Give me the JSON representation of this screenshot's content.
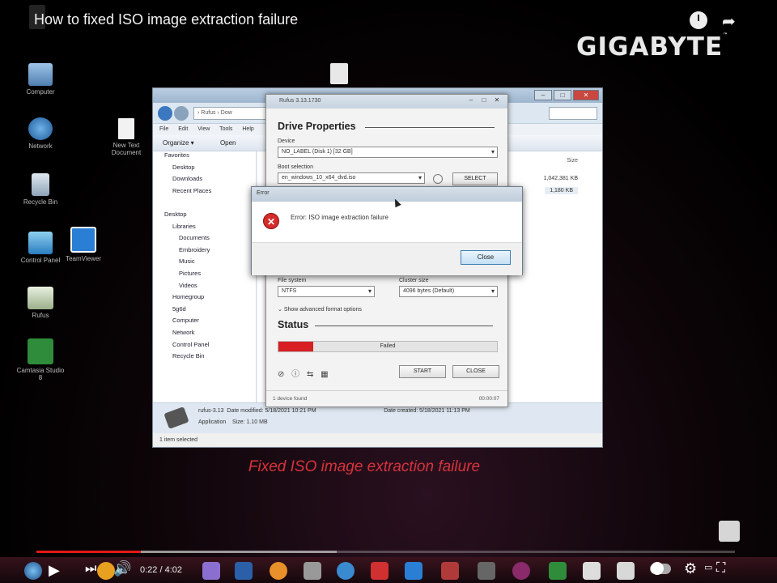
{
  "video": {
    "title": "How to fixed ISO image extraction failure",
    "brand": "GIGABYTE",
    "brand_tm": "™",
    "caption": "Fixed ISO image extraction failure",
    "time": "0:22 / 4:02",
    "progress": 0.15,
    "buffered": 0.43
  },
  "desktop": {
    "icons": [
      {
        "label": "Computer",
        "icon": "computer-icon"
      },
      {
        "label": "Network",
        "icon": "network-icon"
      },
      {
        "label": "Recycle Bin",
        "icon": "recycle-bin-icon"
      },
      {
        "label": "Control Panel",
        "icon": "control-panel-icon"
      },
      {
        "label": "TeamViewer",
        "icon": "teamviewer-icon"
      },
      {
        "label": "Rufus",
        "icon": "rufus-icon"
      },
      {
        "label": "Camtasia Studio 8",
        "icon": "camtasia-icon"
      },
      {
        "label": "New Text Document",
        "icon": "text-document-icon"
      }
    ]
  },
  "explorer": {
    "address": "› Rufus › Dow",
    "menu": "File Edit View Tools Help",
    "toolbar": [
      "Organize ▾",
      "Open"
    ],
    "nav": [
      {
        "label": "Favorites",
        "level": 0
      },
      {
        "label": "Desktop",
        "level": 1
      },
      {
        "label": "Downloads",
        "level": 1
      },
      {
        "label": "Recent Places",
        "level": 1
      },
      {
        "label": "",
        "level": 1
      },
      {
        "label": "Desktop",
        "level": 0
      },
      {
        "label": "Libraries",
        "level": 1
      },
      {
        "label": "Documents",
        "level": 2
      },
      {
        "label": "Embroidery",
        "level": 2
      },
      {
        "label": "Music",
        "level": 2
      },
      {
        "label": "Pictures",
        "level": 2
      },
      {
        "label": "Videos",
        "level": 2
      },
      {
        "label": "Homegroup",
        "level": 1
      },
      {
        "label": "5g6d",
        "level": 1
      },
      {
        "label": "Computer",
        "level": 1
      },
      {
        "label": "Network",
        "level": 1
      },
      {
        "label": "Control Panel",
        "level": 1
      },
      {
        "label": "Recycle Bin",
        "level": 1
      }
    ],
    "col_size": "Size",
    "row1_size": "1,042,381 KB",
    "row2_size": "1,180 KB",
    "details_name": "rufus-3.13",
    "details_modified": "Date modified: 5/18/2021 10:21 PM",
    "details_created": "Date created: 5/18/2021 11:13 PM",
    "details_type": "Application",
    "details_size": "Size: 1.10 MB",
    "status": "1 item selected"
  },
  "rufus": {
    "window_title": "Rufus 3.13.1730",
    "heading_drive": "Drive Properties",
    "device_label": "Device",
    "device_value": "NO_LABEL (Disk 1) [32 GB]",
    "boot_label": "Boot selection",
    "boot_value": "en_windows_10_x64_dvd.iso",
    "select_button": "SELECT",
    "fs_label": "File system",
    "fs_value": "NTFS",
    "cluster_label": "Cluster size",
    "cluster_value": "4096 bytes (Default)",
    "advanced_label": "Show advanced format options",
    "heading_status": "Status",
    "progress_text": "Failed",
    "progress_fraction": 0.16,
    "start_button": "START",
    "close_button": "CLOSE",
    "footer_left": "1 device found",
    "footer_right": "00:00:07"
  },
  "error": {
    "title": "Error",
    "message": "Error: ISO image extraction failure",
    "close_button": "Close"
  },
  "colors": {
    "caption": "#d8333b",
    "progress": "#d71f24",
    "video_played": "#e21818"
  }
}
